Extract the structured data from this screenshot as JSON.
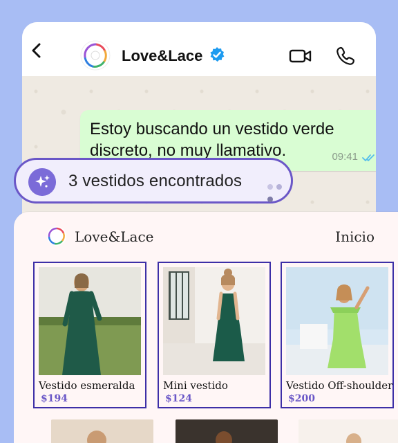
{
  "header": {
    "title": "Love&Lace",
    "icons": {
      "back": "back-chevron-icon",
      "verified": "verified-badge-icon",
      "video": "video-call-icon",
      "call": "phone-call-icon"
    }
  },
  "chat": {
    "message_text": "Estoy buscando un vestido verde discreto, no muy llamativo.",
    "message_time": "09:41",
    "status_icon": "double-check-icon"
  },
  "results": {
    "label": "3 vestidos encontrados",
    "icon": "sparkles-icon"
  },
  "shop": {
    "brand_name": "Love&Lace",
    "nav_home": "Inicio",
    "products": [
      {
        "name": "Vestido esmeralda",
        "price": "$194"
      },
      {
        "name": "Mini vestido",
        "price": "$124"
      },
      {
        "name": "Vestido Off-shoulder",
        "price": "$200"
      }
    ]
  },
  "colors": {
    "frame_bg": "#a8bdf4",
    "accent": "#6a57c7",
    "bubble_bg": "#d9fdd3",
    "verified": "#1d9bf0",
    "card_border": "#3d2fa7"
  }
}
